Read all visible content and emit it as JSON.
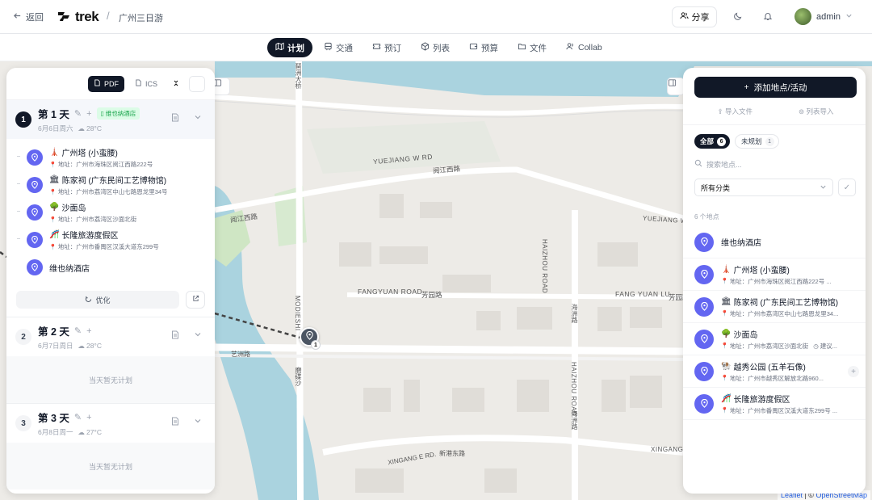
{
  "header": {
    "back_label": "返回",
    "logo_text": "trek",
    "breadcrumb_sep": "/",
    "trip_title": "广州三日游",
    "share_label": "分享",
    "user_name": "admin"
  },
  "tabs": [
    {
      "label": "计划",
      "icon": "map-icon",
      "active": true
    },
    {
      "label": "交通",
      "icon": "transport-icon"
    },
    {
      "label": "预订",
      "icon": "ticket-icon"
    },
    {
      "label": "列表",
      "icon": "package-icon"
    },
    {
      "label": "预算",
      "icon": "wallet-icon"
    },
    {
      "label": "文件",
      "icon": "folder-icon"
    },
    {
      "label": "Collab",
      "icon": "users-icon"
    }
  ],
  "left_toolbar": {
    "pdf_label": "PDF",
    "ics_label": "ICS"
  },
  "days": [
    {
      "num": "1",
      "title": "第 1 天",
      "date": "6月6日周六",
      "weather": "28°C",
      "hotel_badge": "维也纳酒店",
      "places": [
        {
          "emoji": "🗼",
          "name": "广州塔 (小蛮腰)",
          "addr": "地址：广州市海珠区阅江西路222号"
        },
        {
          "emoji": "🏛",
          "name": "陈家祠 (广东民间工艺博物馆)",
          "addr": "地址：广州市荔湾区中山七路恩龙里34号"
        },
        {
          "emoji": "🌳",
          "name": "沙面岛",
          "addr": "地址：广州市荔湾区沙面北街"
        },
        {
          "emoji": "🎢",
          "name": "长隆旅游度假区",
          "addr": "地址：广州市番禺区汉溪大道东299号"
        },
        {
          "emoji": "",
          "name": "维也纳酒店",
          "addr": ""
        }
      ],
      "optimize_label": "优化"
    },
    {
      "num": "2",
      "title": "第 2 天",
      "date": "6月7日周日",
      "weather": "28°C",
      "empty": "当天暂无计划"
    },
    {
      "num": "3",
      "title": "第 3 天",
      "date": "6月8日周一",
      "weather": "27°C",
      "empty": "当天暂无计划"
    }
  ],
  "right_panel": {
    "add_label": "添加地点/活动",
    "import_file": "导入文件",
    "import_list": "列表导入",
    "filter_all": "全部",
    "filter_all_count": "6",
    "filter_unplanned": "未规划",
    "filter_unplanned_count": "1",
    "search_placeholder": "搜索地点...",
    "category": "所有分类",
    "count_label": "6 个地点",
    "places": [
      {
        "emoji": "",
        "name": "维也纳酒店",
        "addr": ""
      },
      {
        "emoji": "🗼",
        "name": "广州塔 (小蛮腰)",
        "addr": "地址：广州市海珠区阅江西路222号 ..."
      },
      {
        "emoji": "🏛",
        "name": "陈家祠 (广东民间工艺博物馆)",
        "addr": "地址：广州市荔湾区中山七路恩龙里34..."
      },
      {
        "emoji": "🌳",
        "name": "沙面岛",
        "addr": "地址：广州市荔湾区沙面北街",
        "extra": "建议..."
      },
      {
        "emoji": "🐏",
        "name": "越秀公园 (五羊石像)",
        "addr": "地址：广州市越秀区解放北路960...",
        "unplanned": true
      },
      {
        "emoji": "🎢",
        "name": "长隆旅游度假区",
        "addr": "地址：广州市番禺区汉溪大道东299号 ..."
      }
    ]
  },
  "map": {
    "labels": [
      "YUEJIANG W RD",
      "阅江西路",
      "阅江西路",
      "FANGYUAN ROAD",
      "芳园路",
      "FANG YUAN LU",
      "芳园路",
      "HAIZHOU ROAD",
      "海洲路",
      "HAIZHOU ROAD",
      "海洲路",
      "XINGANG E RD.",
      "新港东路",
      "XINGANG E RD.",
      "艺洲路",
      "MODIESHI",
      "磨碟沙",
      "YUEJIANG W RD",
      "琶洲大桥",
      "XINGANG"
    ],
    "marker_count": "1",
    "attribution_leaflet": "Leaflet",
    "attribution_osm": "OpenStreetMap"
  },
  "colors": {
    "accent": "#6366f1",
    "dark": "#111827",
    "hotel_badge_bg": "#dcfce7"
  }
}
